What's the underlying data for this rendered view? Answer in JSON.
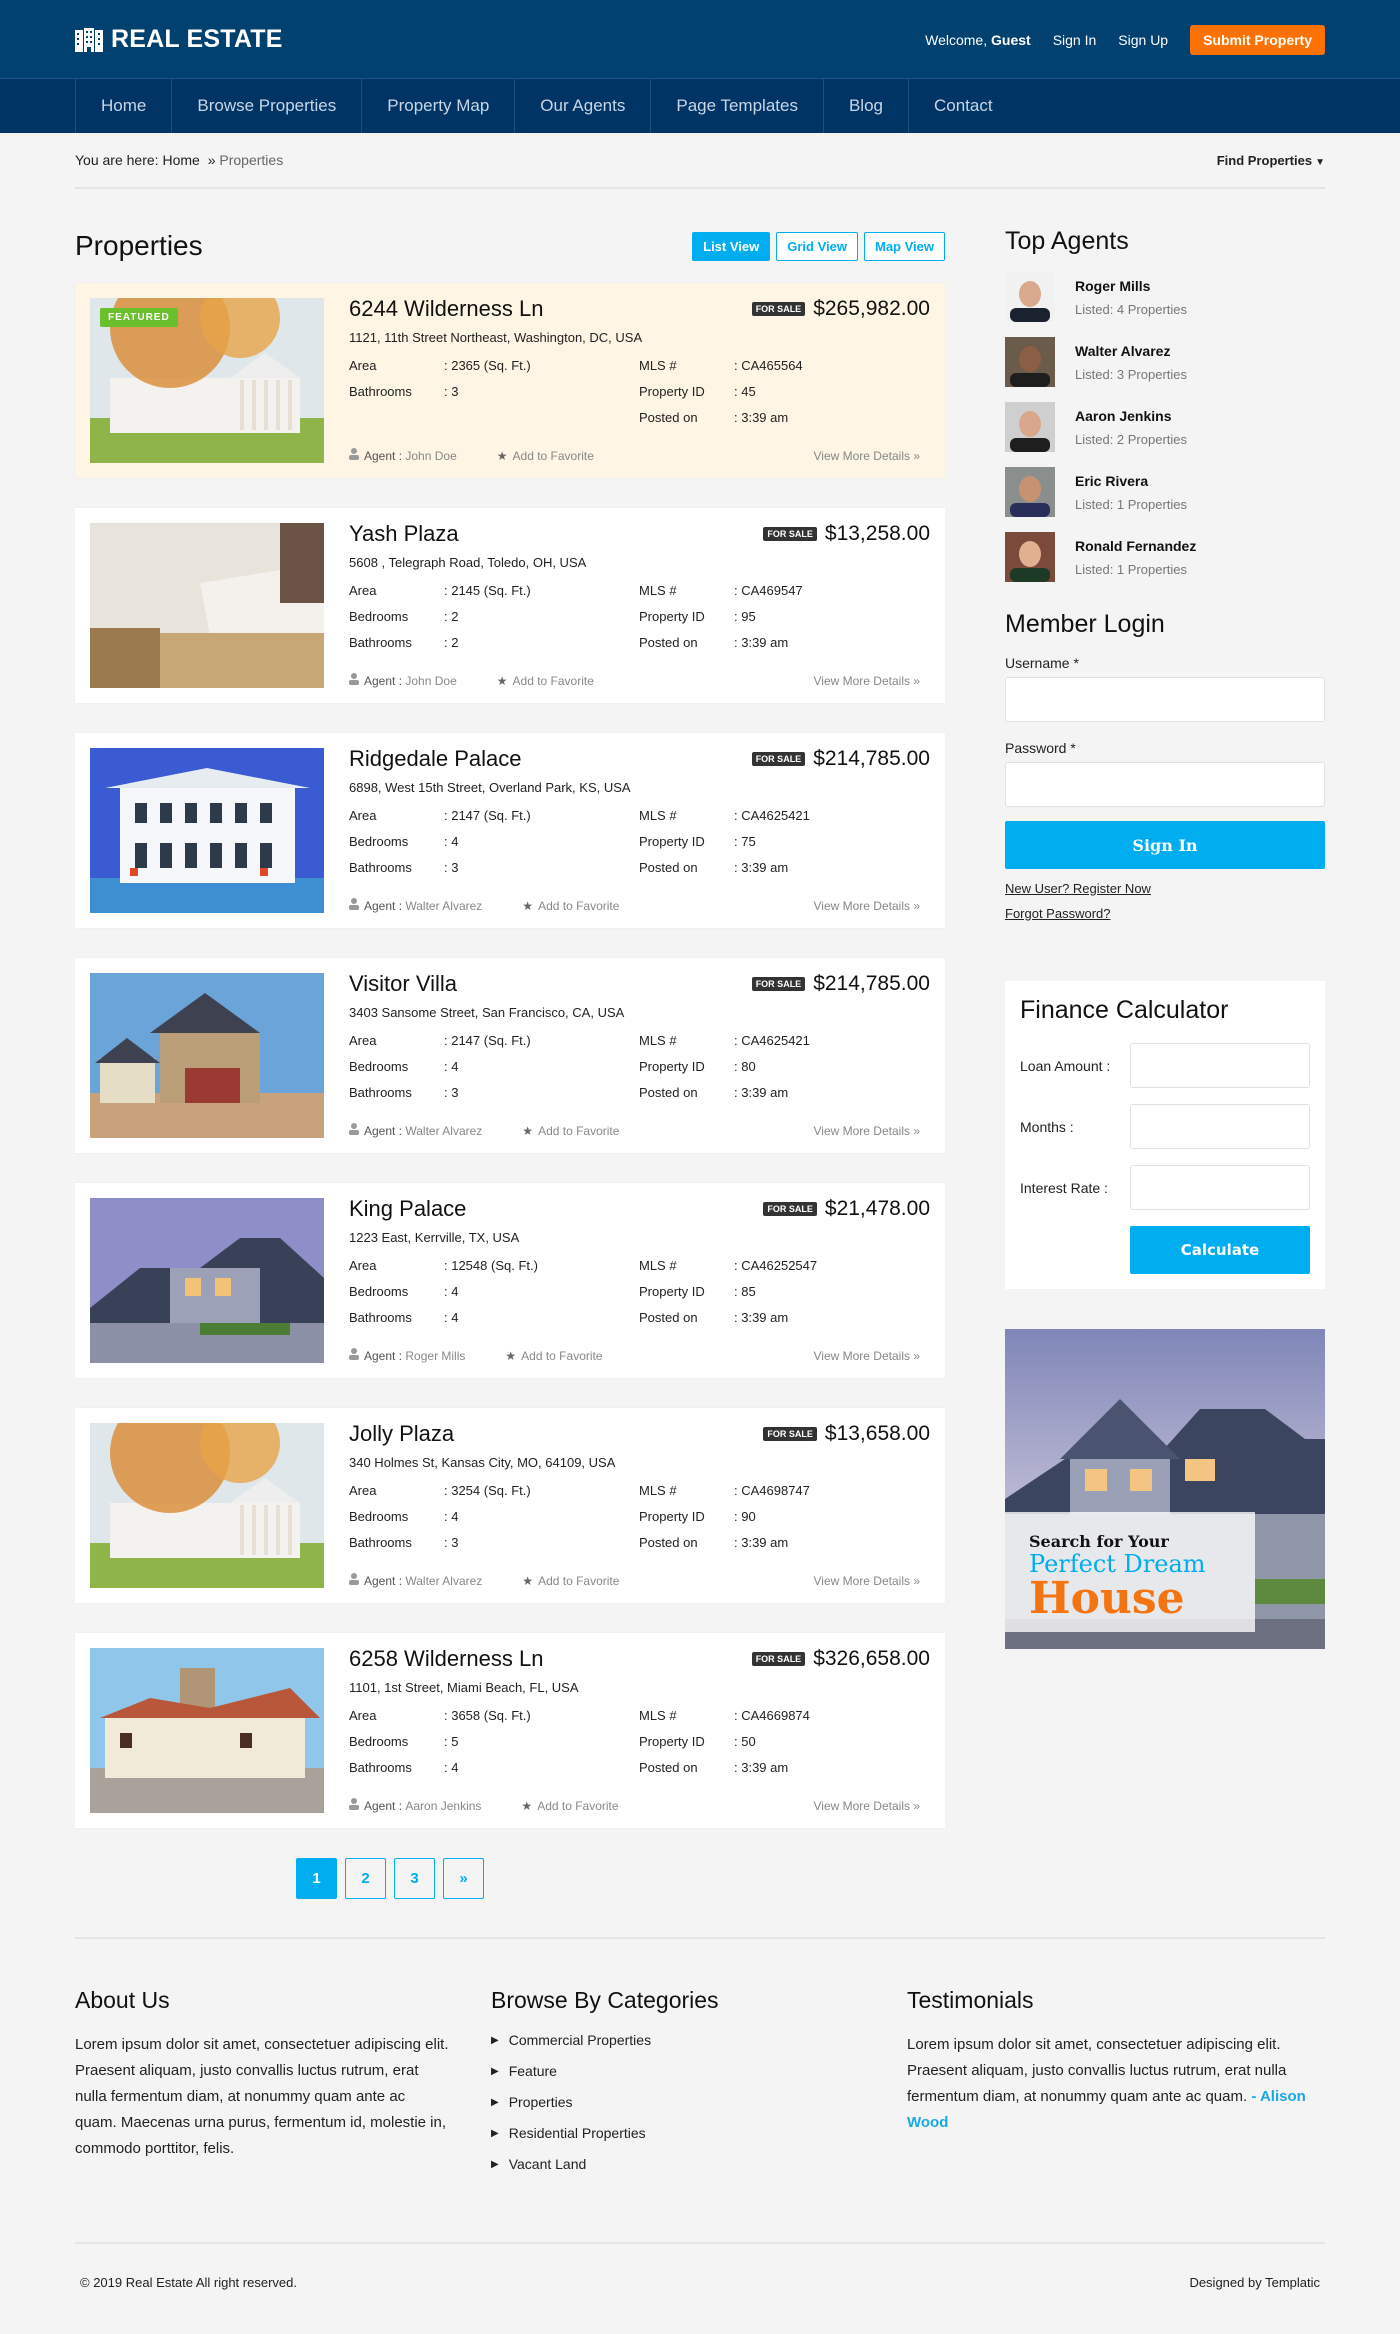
{
  "header": {
    "logo_text": "REAL ESTATE",
    "welcome_prefix": "Welcome,",
    "welcome_user": "Guest",
    "sign_in": "Sign In",
    "sign_up": "Sign Up",
    "submit_property": "Submit Property"
  },
  "nav": [
    "Home",
    "Browse Properties",
    "Property Map",
    "Our Agents",
    "Page Templates",
    "Blog",
    "Contact"
  ],
  "breadcrumb": {
    "prefix": "You are here:",
    "home": "Home",
    "sep": "»",
    "current": "Properties",
    "find_properties": "Find Properties"
  },
  "main": {
    "title": "Properties",
    "views": [
      "List View",
      "Grid View",
      "Map View"
    ],
    "active_view": "List View",
    "featured_label": "FEATURED",
    "for_sale_label": "FOR SALE",
    "agent_label": "Agent :",
    "favorite_label": "Add to Favorite",
    "more_label": "View More Details »",
    "labels": {
      "area": "Area",
      "bedrooms": "Bedrooms",
      "bathrooms": "Bathrooms",
      "mls": "MLS #",
      "property_id": "Property ID",
      "posted_on": "Posted on"
    }
  },
  "properties": [
    {
      "title": "6244 Wilderness Ln",
      "price": "$265,982.00",
      "address": "1121, 11th Street Northeast, Washington, DC, USA",
      "area": ": 2365 (Sq. Ft.)",
      "bedrooms": null,
      "bathrooms": ": 3",
      "mls": ": CA465564",
      "property_id": ": 45",
      "posted_on": ": 3:39 am",
      "agent": "John Doe",
      "featured": true
    },
    {
      "title": "Yash Plaza",
      "price": "$13,258.00",
      "address": "5608 , Telegraph Road, Toledo, OH, USA",
      "area": ": 2145 (Sq. Ft.)",
      "bedrooms": ": 2",
      "bathrooms": ": 2",
      "mls": ": CA469547",
      "property_id": ": 95",
      "posted_on": ": 3:39 am",
      "agent": "John Doe",
      "featured": false
    },
    {
      "title": "Ridgedale Palace",
      "price": "$214,785.00",
      "address": "6898, West 15th Street, Overland Park, KS, USA",
      "area": ": 2147 (Sq. Ft.)",
      "bedrooms": ": 4",
      "bathrooms": ": 3",
      "mls": ": CA4625421",
      "property_id": ": 75",
      "posted_on": ": 3:39 am",
      "agent": "Walter Alvarez",
      "featured": false
    },
    {
      "title": "Visitor Villa",
      "price": "$214,785.00",
      "address": "3403 Sansome Street, San Francisco, CA, USA",
      "area": ": 2147 (Sq. Ft.)",
      "bedrooms": ": 4",
      "bathrooms": ": 3",
      "mls": ": CA4625421",
      "property_id": ": 80",
      "posted_on": ": 3:39 am",
      "agent": "Walter Alvarez",
      "featured": false
    },
    {
      "title": "King Palace",
      "price": "$21,478.00",
      "address": "1223 East, Kerrville, TX, USA",
      "area": ": 12548 (Sq. Ft.)",
      "bedrooms": ": 4",
      "bathrooms": ": 4",
      "mls": ": CA46252547",
      "property_id": ": 85",
      "posted_on": ": 3:39 am",
      "agent": "Roger Mills",
      "featured": false
    },
    {
      "title": "Jolly Plaza",
      "price": "$13,658.00",
      "address": "340 Holmes St, Kansas City, MO, 64109, USA",
      "area": ": 3254 (Sq. Ft.)",
      "bedrooms": ": 4",
      "bathrooms": ": 3",
      "mls": ": CA4698747",
      "property_id": ": 90",
      "posted_on": ": 3:39 am",
      "agent": "Walter Alvarez",
      "featured": false
    },
    {
      "title": "6258 Wilderness Ln",
      "price": "$326,658.00",
      "address": "1101, 1st Street, Miami Beach, FL, USA",
      "area": ": 3658 (Sq. Ft.)",
      "bedrooms": ": 5",
      "bathrooms": ": 4",
      "mls": ": CA4669874",
      "property_id": ": 50",
      "posted_on": ": 3:39 am",
      "agent": "Aaron Jenkins",
      "featured": false
    }
  ],
  "pagination": {
    "pages": [
      "1",
      "2",
      "3",
      "»"
    ],
    "current": "1"
  },
  "sidebar": {
    "top_agents_title": "Top Agents",
    "agents": [
      {
        "name": "Roger Mills",
        "listed": "Listed: 4 Properties"
      },
      {
        "name": "Walter Alvarez",
        "listed": "Listed: 3 Properties"
      },
      {
        "name": "Aaron Jenkins",
        "listed": "Listed: 2 Properties"
      },
      {
        "name": "Eric Rivera",
        "listed": "Listed: 1 Properties"
      },
      {
        "name": "Ronald Fernandez",
        "listed": "Listed: 1 Properties"
      }
    ],
    "login": {
      "title": "Member Login",
      "username_label": "Username *",
      "username_value": "",
      "password_label": "Password *",
      "password_value": "",
      "sign_in": "Sign In",
      "register": "New User? Register Now",
      "forgot": "Forgot Password?"
    },
    "calculator": {
      "title": "Finance Calculator",
      "loan_label": "Loan Amount :",
      "months_label": "Months :",
      "rate_label": "Interest Rate :",
      "button": "Calculate"
    },
    "ad": {
      "line1": "Search for Your",
      "line2": "Perfect Dream",
      "line3": "House"
    }
  },
  "footer": {
    "about_title": "About Us",
    "about_text": "Lorem ipsum dolor sit amet, consectetuer adipiscing elit. Praesent aliquam, justo convallis luctus rutrum, erat nulla fermentum diam, at nonummy quam ante ac quam. Maecenas urna purus, fermentum id, molestie in, commodo porttitor, felis.",
    "categories_title": "Browse By Categories",
    "categories": [
      "Commercial Properties",
      "Feature",
      "Properties",
      "Residential Properties",
      "Vacant Land"
    ],
    "testimonials_title": "Testimonials",
    "testimonial_text": "Lorem ipsum dolor sit amet, consectetuer adipiscing elit. Praesent aliquam, justo convallis luctus rutrum, erat nulla fermentum diam, at nonummy quam ante ac quam.",
    "testimonial_author": "- Alison Wood",
    "copyright": "© 2019 Real Estate All right reserved.",
    "designed_by": "Designed by Templatic"
  },
  "colors": {
    "header_bg": "#00416f",
    "nav_bg": "#003464",
    "accent": "#00aeef",
    "submit": "#ff7200",
    "featured_badge": "#6abf2d",
    "featured_card_bg": "#fff5e4"
  }
}
